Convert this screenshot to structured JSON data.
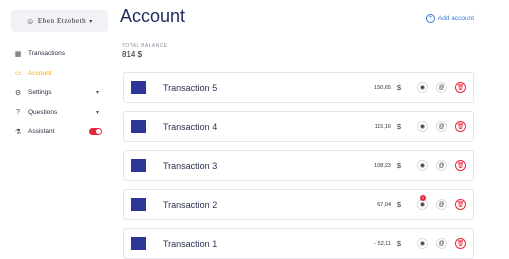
{
  "user": {
    "name": "Eben Etzebeth"
  },
  "sidebar": {
    "items": [
      {
        "label": "Transactions",
        "icon": "grid-icon"
      },
      {
        "label": "Account",
        "icon": "wallet-icon",
        "active": true
      },
      {
        "label": "Settings",
        "icon": "gear-icon"
      },
      {
        "label": "Questions",
        "icon": "question-icon"
      },
      {
        "label": "Assistant",
        "icon": "flask-icon",
        "toggle_on": true
      }
    ]
  },
  "header": {
    "title": "Account",
    "add_account_label": "Add account"
  },
  "balance": {
    "label": "TOTAL BALANCE",
    "value": "814 $"
  },
  "transactions": [
    {
      "name": "Transaction 5",
      "amount": "150,65",
      "currency": "$"
    },
    {
      "name": "Transaction 4",
      "amount": "115,16",
      "currency": "$"
    },
    {
      "name": "Transaction 3",
      "amount": "108,23",
      "currency": "$"
    },
    {
      "name": "Transaction 2",
      "amount": "67,04",
      "currency": "$",
      "badge": "1"
    },
    {
      "name": "Transaction 1",
      "amount": "- 52,11",
      "currency": "$"
    }
  ],
  "colors": {
    "accent": "#f5a31a",
    "danger": "#e8253d",
    "brand": "#2d3596",
    "link": "#3a7bd5"
  }
}
